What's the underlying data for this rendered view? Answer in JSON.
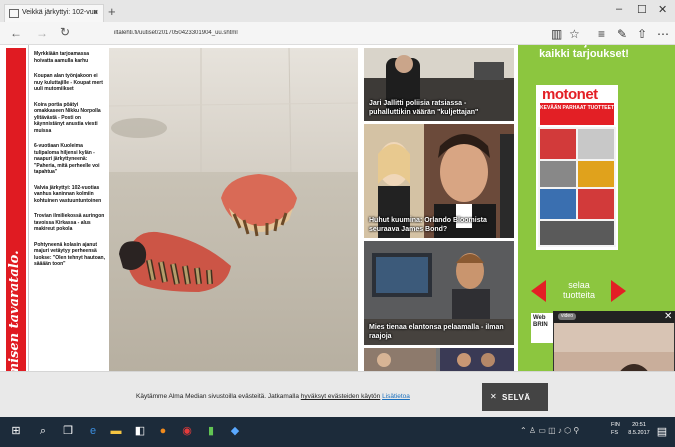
{
  "browser": {
    "tab_title": "Veikkä järkyttyi: 102-vuo",
    "url": "iltalehti.fi/uutiset/2017050423301904_uu.shtml",
    "nav": {
      "back": "←",
      "forward": "→",
      "refresh": "↻"
    },
    "toolbar_icons": [
      "reading-view-icon",
      "favorites-star-icon",
      "hub-icon",
      "notes-icon",
      "share-icon",
      "more-icon"
    ],
    "window_buttons": {
      "minimize": "–",
      "maximize": "☐",
      "close": "✕"
    }
  },
  "page": {
    "red_banner_text": "n ihmisen tavaratalo.",
    "sidebar_items": [
      "Myrkkiään tarjoamassa hoivatta aamulla karhu",
      "Koupan alan työnjakoon ei nuy kuluttajille - Koupat mert uuli mutomiikset",
      "Koira portia pöätyi omakkaseen Nikku Norpolla ylitävästä - Posti on käynnistänyt anustia viesti muissa",
      "6-vuotiaan Kuoleima tulipaloma hiljensi kylän - naapuri järkyttyneenä: \"Paheria, mitä perheelle voi tapahtua\"",
      "Valvia järkyttyi: 102-vuotias vanhus kaninnan kolmiin kohtuinen vastuuntuntoinen",
      "Trovian ilmiliekossä auringon tavoissa Kirkassa - alus makireut pokola",
      "Pohtyneenä kolasin ajanut majuri vetäytyy perheensä luokse: \"Olen tehnyt hautoan, sääään toon\""
    ],
    "cards": [
      {
        "caption": "Jari Jallitti poliisia ratsiassa - puhalluttikin väärän \"kuljettajan\""
      },
      {
        "caption": "Huhut kuumina: Orlando Bloomista seuraava James Bond?"
      },
      {
        "caption": "Mies tienaa elantonsa pelaamalla - ilman raajoja"
      }
    ],
    "ad": {
      "headline": "Klikkaa ja katso kaikki tarjoukset!",
      "brand": "motonet",
      "banner": "KEVÄÄN PARHAAT TUOTTEET",
      "browse": "selaa tuotteita",
      "web_label": "Web BRIN"
    },
    "video_overlay": {
      "logo": "video"
    }
  },
  "cookie_banner": {
    "text_before": "Käytämme Alma Median sivustoilla evästeitä. Jatkamalla",
    "link_text": "hyväksyt evästeiden käytön",
    "more_text": "Lisätietoa",
    "button_label": "SELVÄ",
    "close_glyph": "✕"
  },
  "taskbar": {
    "language": [
      "FIN",
      "FS"
    ],
    "clock_time": "20:51",
    "clock_date": "8.5.2017"
  },
  "colors": {
    "accent_red": "#e01b22",
    "ad_green": "#8cc63f",
    "taskbar": "#1c2b3a",
    "link_blue": "#1a6fbd"
  }
}
